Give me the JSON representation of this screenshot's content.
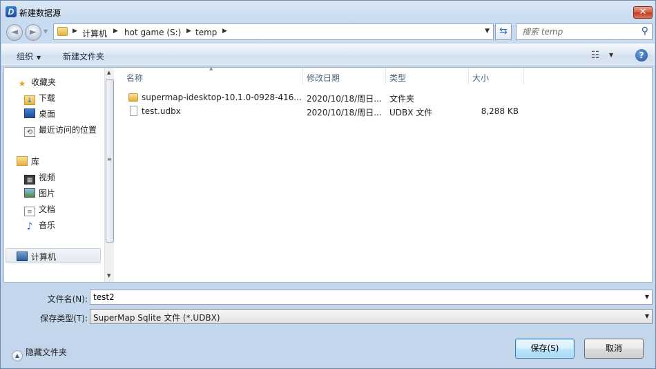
{
  "window": {
    "title": "新建数据源",
    "app_icon_letter": "D",
    "close_glyph": "✕"
  },
  "nav": {
    "back_glyph": "◄",
    "forward_glyph": "►",
    "breadcrumbs": [
      "计算机",
      "hot game (S:)",
      "temp"
    ],
    "search_placeholder": "搜索 temp"
  },
  "toolbar": {
    "organize_label": "组织",
    "new_folder_label": "新建文件夹",
    "help_glyph": "?"
  },
  "sidebar": {
    "favorites": {
      "label": "收藏夹",
      "icon": "star-icon"
    },
    "favorite_items": [
      {
        "label": "下载",
        "icon": "download-folder-icon"
      },
      {
        "label": "桌面",
        "icon": "desktop-icon"
      },
      {
        "label": "最近访问的位置",
        "icon": "recent-places-icon"
      }
    ],
    "libraries": {
      "label": "库",
      "icon": "library-icon"
    },
    "library_items": [
      {
        "label": "视频",
        "icon": "video-icon"
      },
      {
        "label": "图片",
        "icon": "picture-icon"
      },
      {
        "label": "文档",
        "icon": "document-icon"
      },
      {
        "label": "音乐",
        "icon": "music-icon"
      }
    ],
    "computer": {
      "label": "计算机",
      "icon": "computer-icon"
    }
  },
  "columns": {
    "name": "名称",
    "modified": "修改日期",
    "type": "类型",
    "size": "大小"
  },
  "files": [
    {
      "name": "supermap-idesktop-10.1.0-0928-416...",
      "modified": "2020/10/18/周日...",
      "type": "文件夹",
      "size": "",
      "icon": "folder-icon"
    },
    {
      "name": "test.udbx",
      "modified": "2020/10/18/周日...",
      "type": "UDBX 文件",
      "size": "8,288 KB",
      "icon": "file-icon"
    }
  ],
  "form": {
    "filename_label": "文件名(N):",
    "filename_value": "test2",
    "filetype_label": "保存类型(T):",
    "filetype_value": "SuperMap Sqlite 文件 (*.UDBX)"
  },
  "footer": {
    "hide_folders_label": "隐藏文件夹",
    "save_label": "保存(S)",
    "cancel_label": "取消"
  }
}
